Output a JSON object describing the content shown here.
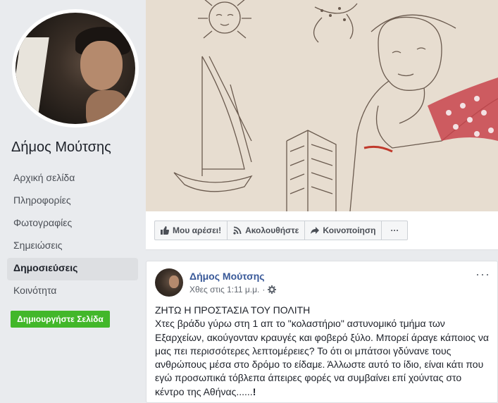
{
  "page": {
    "name": "Δήμος Μούτσης"
  },
  "sidebar": {
    "items": [
      {
        "label": "Αρχική σελίδα",
        "active": false
      },
      {
        "label": "Πληροφορίες",
        "active": false
      },
      {
        "label": "Φωτογραφίες",
        "active": false
      },
      {
        "label": "Σημειώσεις",
        "active": false
      },
      {
        "label": "Δημοσιεύσεις",
        "active": true
      },
      {
        "label": "Κοινότητα",
        "active": false
      }
    ],
    "create_page_label": "Δημιουργήστε Σελίδα"
  },
  "actions": {
    "like_label": "Μου αρέσει!",
    "follow_label": "Ακολουθήστε",
    "share_label": "Κοινοποίηση",
    "more_label": "···"
  },
  "post": {
    "author": "Δήμος Μούτσης",
    "time": "Χθες στις 1:11 μ.μ.",
    "separator": "·",
    "menu_label": "···",
    "title": "ΖΗΤΩ Η ΠΡΟΣΤΑΣΙΑ ΤΟΥ ΠΟΛΙΤΗ",
    "text": "Χτες βράδυ γύρω στη 1 απ το \"κολαστήριο\" αστυνομικό τμήμα των Εξαρχείων, ακούγονταν κραυγές και φοβερό ξύλο. Μπορεί άραγε κάποιος να μας πει περισσότερες λεπτομέρειες? Το ότι οι μπάτσοι γδύνανε τους ανθρώπους μέσα στο δρόμο το είδαμε. Άλλωστε αυτό το ίδιο, είναι κάτι που εγώ προσωπικά τόβλεπα άπειρες φορές να συμβαίνει επί χούντας στο κέντρο της Αθήνας......",
    "ending": "!"
  },
  "colors": {
    "accent": "#385898",
    "create_button": "#42b72a",
    "background": "#e9ebee"
  }
}
